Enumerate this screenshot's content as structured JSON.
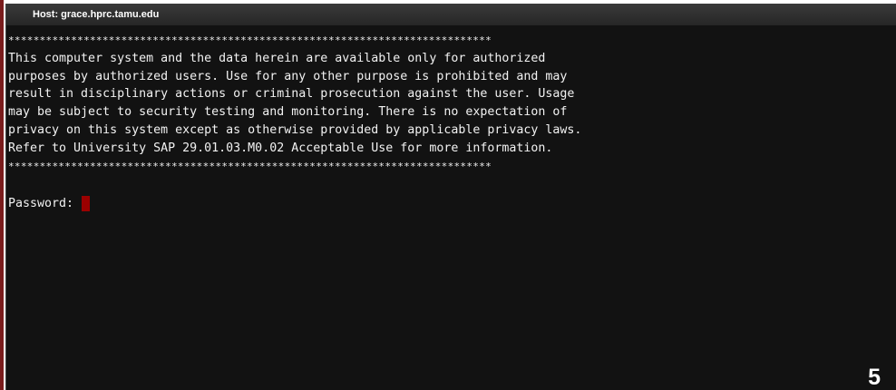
{
  "window": {
    "title": "Host: grace.hprc.tamu.edu"
  },
  "terminal": {
    "stars_top": "*****************************************************************************",
    "lines": [
      "This computer system and the data herein are available only for authorized",
      "purposes by authorized users. Use for any other purpose is prohibited and may",
      "result in disciplinary actions or criminal prosecution against the user. Usage",
      "may be subject to security testing and monitoring. There is no expectation of",
      "privacy on this system except as otherwise provided by applicable privacy laws.",
      "Refer to University SAP 29.01.03.M0.02 Acceptable Use for more information."
    ],
    "stars_bottom": "*****************************************************************************",
    "prompt": "Password: "
  },
  "slide": {
    "number": "5"
  },
  "colors": {
    "terminal_bg": "#121212",
    "terminal_text": "#f2f2f2",
    "cursor": "#9b0000",
    "title_bar": "#2f2f2f"
  }
}
